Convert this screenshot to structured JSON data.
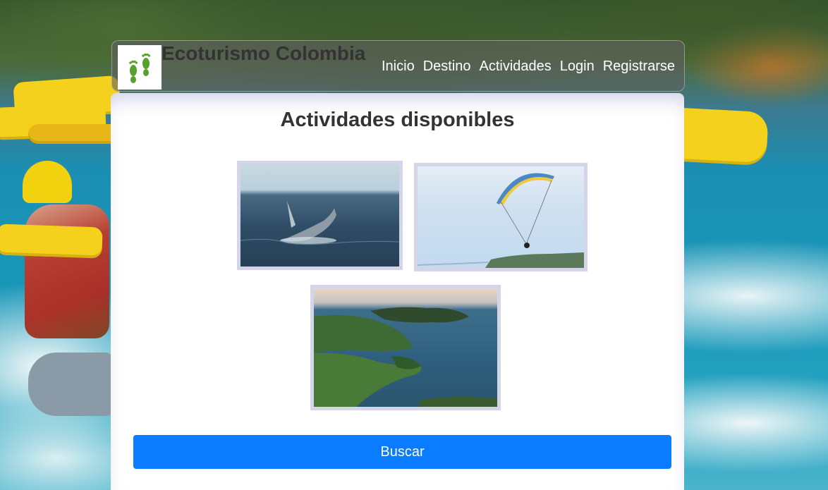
{
  "header": {
    "brand": "Ecoturismo Colombia",
    "logo_icon": "green-footprints-icon",
    "nav": [
      {
        "label": "Inicio"
      },
      {
        "label": "Destino"
      },
      {
        "label": "Actividades"
      },
      {
        "label": "Login"
      },
      {
        "label": "Registrarse"
      }
    ]
  },
  "main": {
    "title": "Actividades disponibles",
    "gallery": [
      {
        "subject": "whale-breaching-photo"
      },
      {
        "subject": "paragliding-photo"
      },
      {
        "subject": "tropical-coast-photo"
      }
    ],
    "search_label": "Buscar"
  },
  "colors": {
    "primary_button": "#0a7cff",
    "photo_border": "#d5d5ea",
    "logo_green": "#5aa02c"
  }
}
